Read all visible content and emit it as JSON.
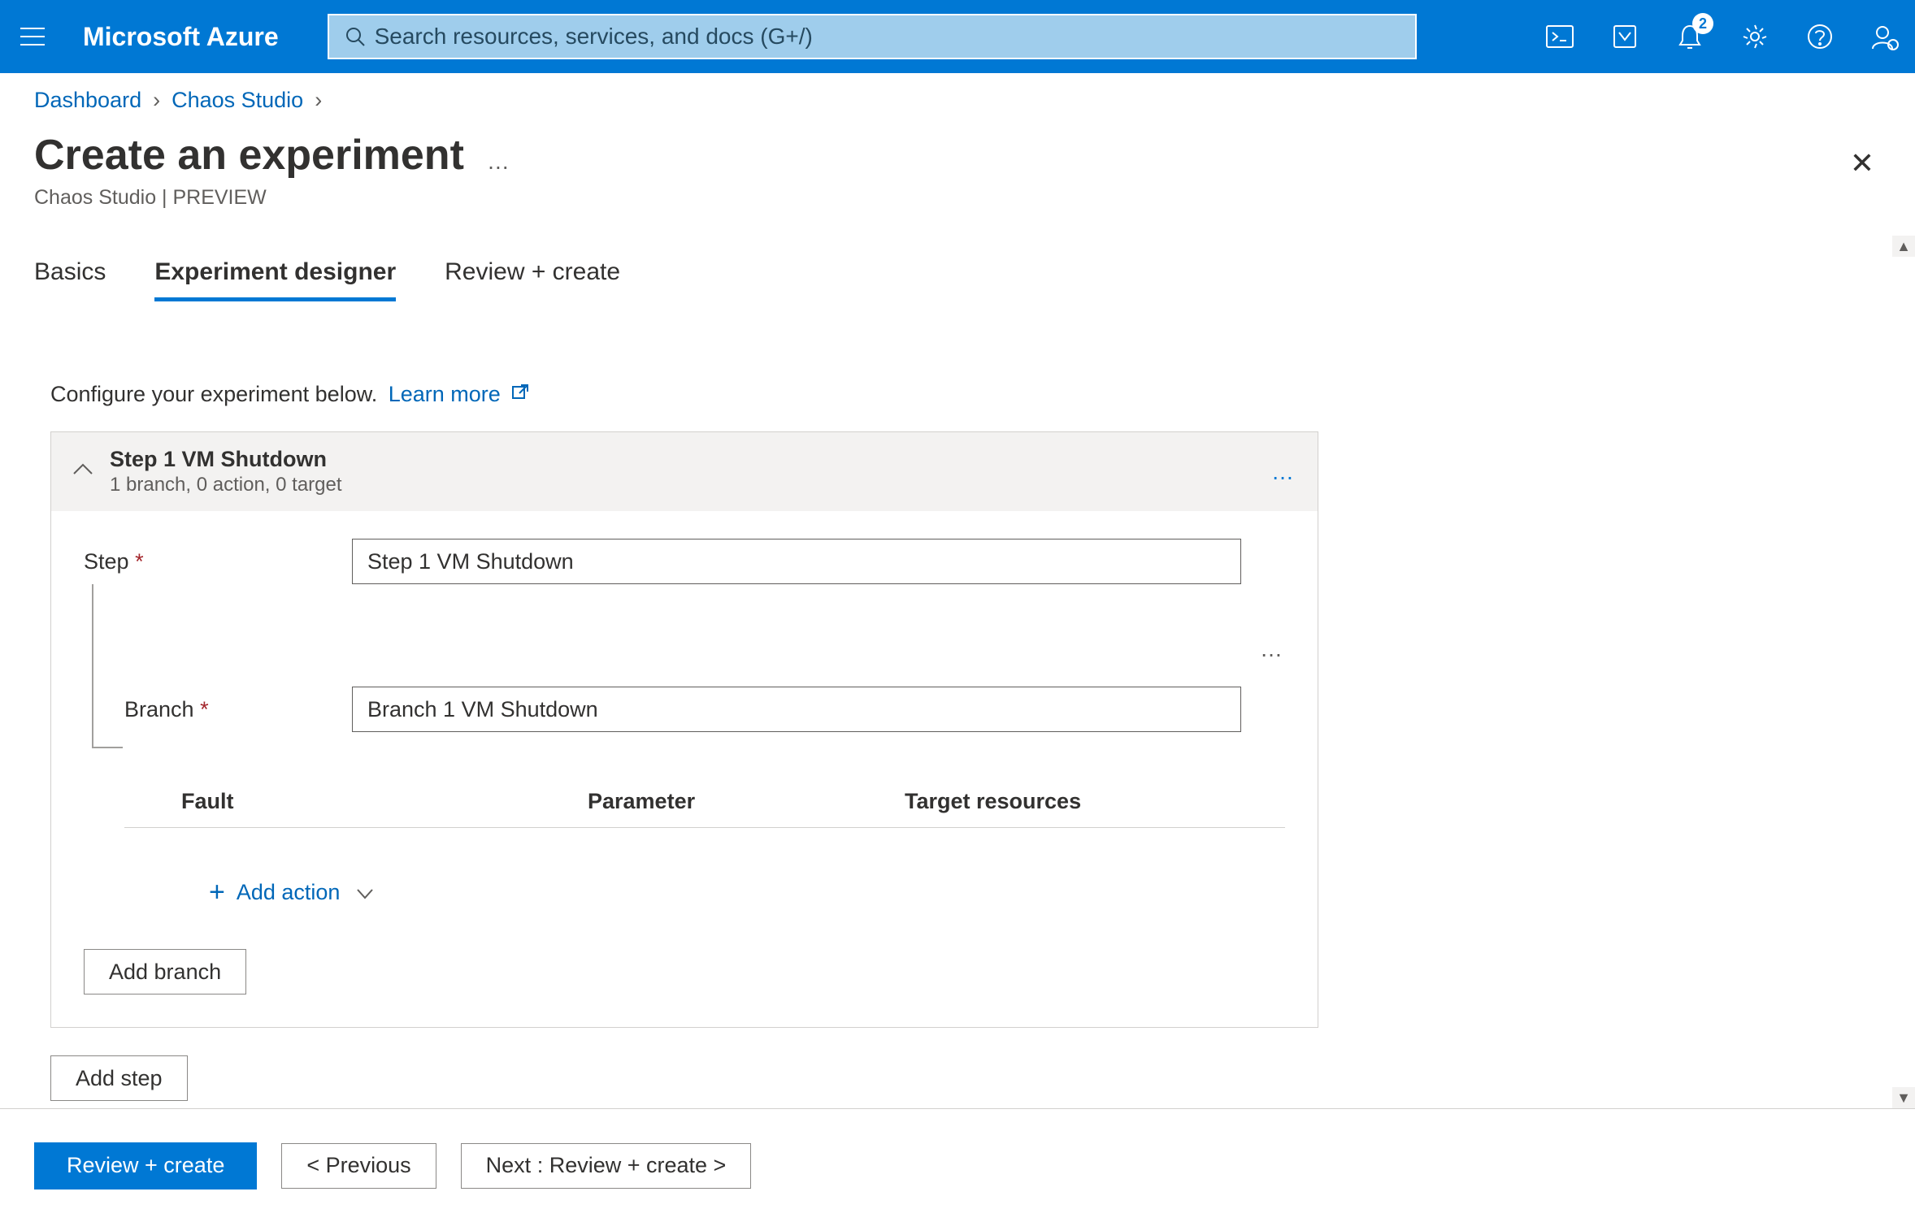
{
  "header": {
    "brand": "Microsoft Azure",
    "search_placeholder": "Search resources, services, and docs (G+/)",
    "notification_count": "2"
  },
  "breadcrumb": {
    "items": [
      "Dashboard",
      "Chaos Studio"
    ]
  },
  "page": {
    "title": "Create an experiment",
    "subtitle": "Chaos Studio | PREVIEW"
  },
  "tabs": [
    "Basics",
    "Experiment designer",
    "Review + create"
  ],
  "configure": {
    "text": "Configure your experiment below.",
    "learn_more": "Learn more"
  },
  "step": {
    "title": "Step 1 VM Shutdown",
    "summary": "1 branch, 0 action, 0 target",
    "label_step": "Step",
    "input_step": "Step 1 VM Shutdown",
    "label_branch": "Branch",
    "input_branch": "Branch 1 VM Shutdown",
    "columns": {
      "fault": "Fault",
      "parameter": "Parameter",
      "target": "Target resources"
    },
    "add_action": "Add action",
    "add_branch": "Add branch"
  },
  "add_step": "Add step",
  "footer": {
    "review": "Review + create",
    "previous": "<  Previous",
    "next": "Next : Review + create  >"
  }
}
